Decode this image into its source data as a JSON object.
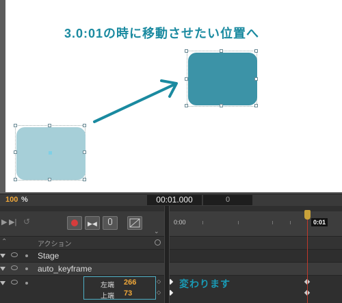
{
  "stage": {
    "annotation": "3.0:01の時に移動させたい位置へ"
  },
  "zoom_bar": {
    "zoom_value": "100",
    "zoom_unit": "%",
    "current_time": "00:01.000",
    "frame": "0"
  },
  "timeline": {
    "header_actions": "アクション",
    "ruler_start": "0:00",
    "playhead_label": "0:01",
    "rows": {
      "stage": "Stage",
      "element": "auto_keyframe"
    },
    "properties": {
      "left_label": "左端",
      "left_value": "266",
      "top_label": "上端",
      "top_value": "73"
    },
    "note": "変わります"
  },
  "colors": {
    "start_rect": "#a6cfd8",
    "end_rect": "#3c93a7",
    "accent": "#1a9ab5",
    "value": "#f0a83a",
    "playhead": "#c0392b"
  }
}
